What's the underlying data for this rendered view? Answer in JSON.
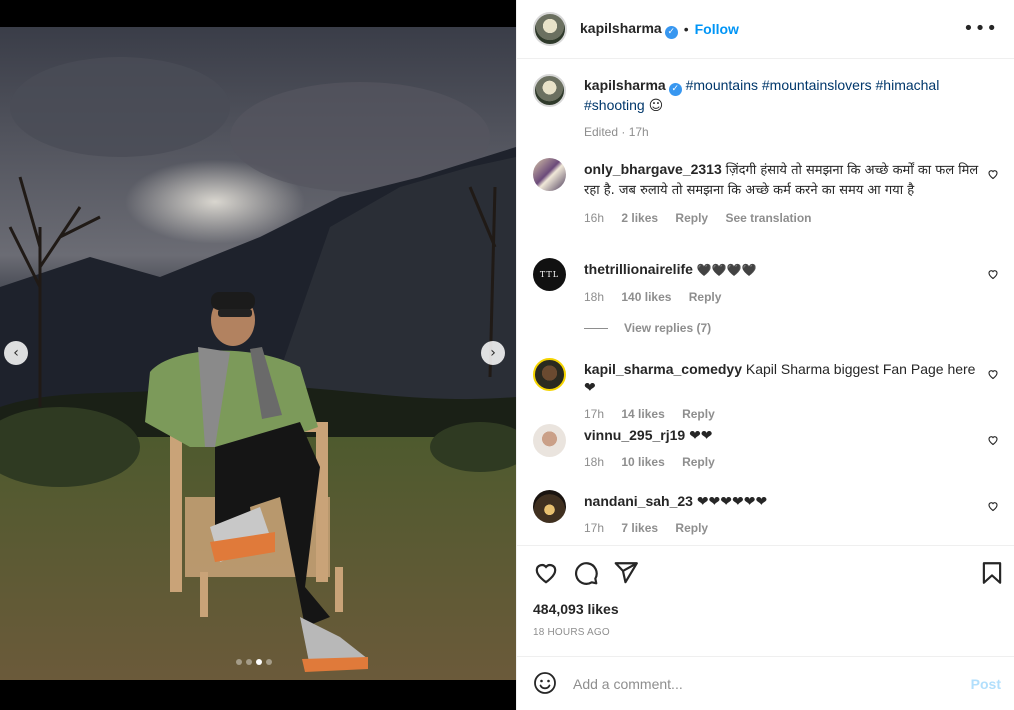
{
  "post": {
    "author": "kapilsharma",
    "follow_label": "Follow",
    "separator": "•",
    "more_icon": "more-horizontal-icon",
    "verified_glyph": "✓"
  },
  "caption": {
    "username": "kapilsharma",
    "hashtags": [
      "#mountains",
      "#mountainslovers",
      "#himachal",
      "#shooting"
    ],
    "emoji": "☺",
    "edited": "Edited · 17h"
  },
  "comments": [
    {
      "username": "only_bhargave_2313",
      "text": "ज़िंदगी हंसाये तो समझना कि अच्छे कर्मों का फल मिल रहा है. जब रुलाये तो समझना कि अच्छे कर्म करने का समय आ गया है",
      "time": "16h",
      "likes": "2 likes",
      "reply": "Reply",
      "extra": "See translation"
    },
    {
      "username": "thetrillionairelife",
      "text": "🖤🖤🖤🖤",
      "time": "18h",
      "likes": "140 likes",
      "reply": "Reply",
      "view_replies": "View replies (7)",
      "avatar_text": "TTL"
    },
    {
      "username": "kapil_sharma_comedyy",
      "text": "Kapil Sharma biggest Fan Page here ❤",
      "time": "17h",
      "likes": "14 likes",
      "reply": "Reply"
    },
    {
      "username": "vinnu_295_rj19",
      "text": "❤❤",
      "time": "18h",
      "likes": "10 likes",
      "reply": "Reply"
    },
    {
      "username": "nandani_sah_23",
      "text": "❤❤❤❤❤❤",
      "time": "17h",
      "likes": "7 likes",
      "reply": "Reply"
    }
  ],
  "actions": {
    "likes": "484,093 likes",
    "time_ago": "18 HOURS AGO",
    "comment_placeholder": "Add a comment...",
    "post_label": "Post"
  },
  "carousel": {
    "prev": "‹",
    "next": "›",
    "active_index": 2,
    "count": 4
  }
}
